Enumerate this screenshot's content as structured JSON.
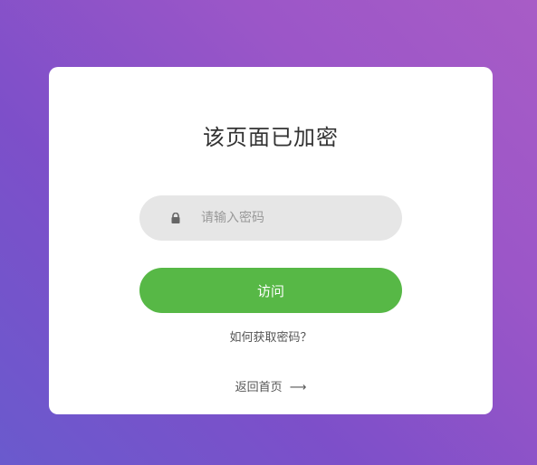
{
  "card": {
    "title": "该页面已加密",
    "password_placeholder": "请输入密码",
    "password_value": "",
    "lock_icon": "lock-icon",
    "visit_label": "访问",
    "help_link": "如何获取密码？",
    "home_link": "返回首页",
    "home_arrow": "⟶"
  },
  "colors": {
    "background_gradient": [
      "#6a5acd",
      "#a85cc6"
    ],
    "card": "#ffffff",
    "input_bg": "#e6e6e6",
    "button": "#57b846",
    "title_text": "#333333",
    "link_text": "#555555"
  }
}
